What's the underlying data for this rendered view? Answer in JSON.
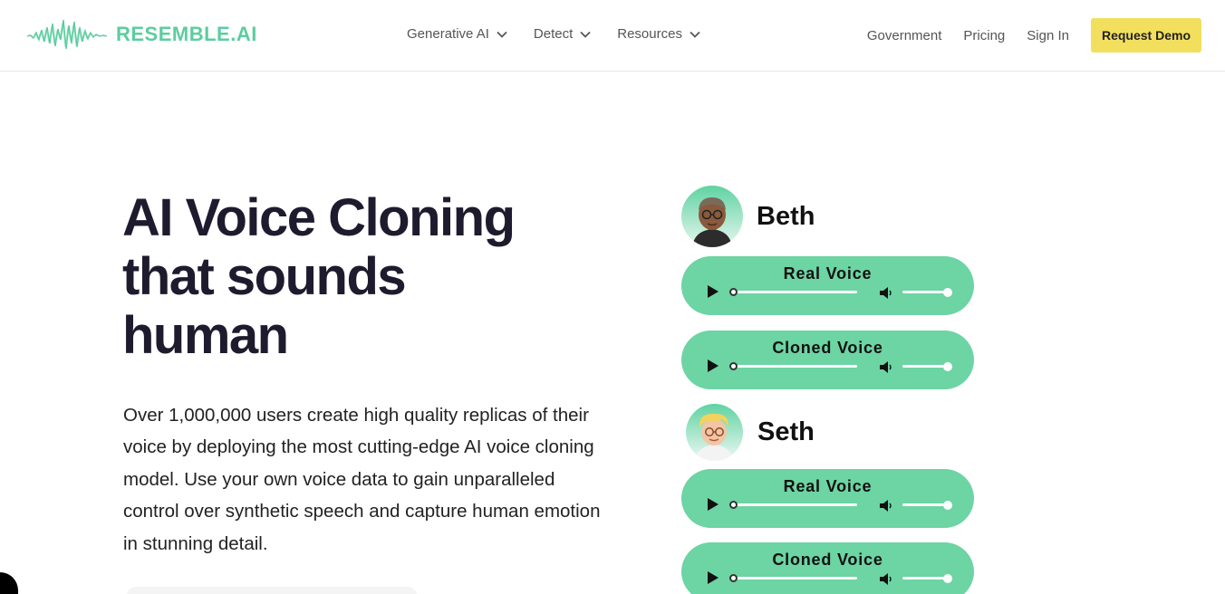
{
  "brand": {
    "name": "RESEMBLE.AI",
    "color": "#5ccda0"
  },
  "nav": {
    "menus": [
      "Generative AI",
      "Detect",
      "Resources"
    ],
    "links": [
      "Government",
      "Pricing",
      "Sign In"
    ],
    "cta": "Request Demo",
    "cta_color": "#f3df5e"
  },
  "hero": {
    "title_lines": [
      "AI Voice Cloning",
      "that sounds",
      "human"
    ],
    "description": "Over 1,000,000 users create high quality replicas of their voice by deploying the most cutting-edge AI voice cloning model. Use your own voice data to gain unparalleled control over synthetic speech  and capture human emotion in stunning detail."
  },
  "voices": [
    {
      "name": "Beth",
      "players": [
        {
          "label": "Real Voice",
          "progress": 0,
          "volume": 1
        },
        {
          "label": "Cloned Voice",
          "progress": 0,
          "volume": 1
        }
      ]
    },
    {
      "name": "Seth",
      "players": [
        {
          "label": "Real Voice",
          "progress": 0,
          "volume": 1
        },
        {
          "label": "Cloned Voice",
          "progress": 0,
          "volume": 1
        }
      ]
    }
  ],
  "player_color": "#6dd4a3"
}
